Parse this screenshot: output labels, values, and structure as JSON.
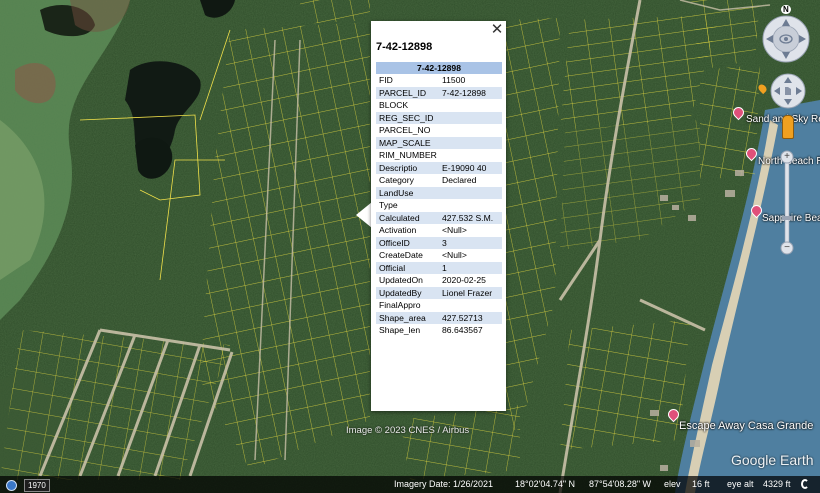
{
  "parcel_id": "7-42-12898",
  "table_header": "7-42-12898",
  "close_glyph": "✕",
  "attributes": [
    {
      "key": "FID",
      "value": "11500"
    },
    {
      "key": "PARCEL_ID",
      "value": "7-42-12898"
    },
    {
      "key": "BLOCK",
      "value": ""
    },
    {
      "key": "REG_SEC_ID",
      "value": ""
    },
    {
      "key": "PARCEL_NO",
      "value": ""
    },
    {
      "key": "MAP_SCALE",
      "value": ""
    },
    {
      "key": "RIM_NUMBER",
      "value": ""
    },
    {
      "key": "Descriptio",
      "value": "E-19090 40"
    },
    {
      "key": "Category",
      "value": "Declared"
    },
    {
      "key": "LandUse",
      "value": ""
    },
    {
      "key": "Type",
      "value": ""
    },
    {
      "key": "Calculated",
      "value": "427.532 S.M."
    },
    {
      "key": "Activation",
      "value": "<Null>"
    },
    {
      "key": "OfficeID",
      "value": "3"
    },
    {
      "key": "CreateDate",
      "value": "<Null>"
    },
    {
      "key": "Official",
      "value": "1"
    },
    {
      "key": "UpdatedOn",
      "value": "2020-02-25"
    },
    {
      "key": "UpdatedBy",
      "value": "Lionel Frazer"
    },
    {
      "key": "FinalAppro",
      "value": ""
    },
    {
      "key": "Shape_area",
      "value": "427.52713"
    },
    {
      "key": "Shape_len",
      "value": "86.643567"
    }
  ],
  "places": [
    {
      "name": "Sand and Sky Resort",
      "icon": "pin-icon"
    },
    {
      "name": "North Beach Resort",
      "icon": "pin-icon"
    },
    {
      "name": "Sapphire Beach",
      "icon": "pin-icon"
    },
    {
      "name": "Escape Away Casa Grande",
      "icon": "pin-icon"
    }
  ],
  "copyright": "Image © 2023 CNES / Airbus",
  "logo": "Google Earth",
  "status": {
    "year": "1970",
    "imagery_date": "Imagery Date: 1/26/2021",
    "lat": "18°02'04.74\" N",
    "lon": "87°54'08.28\" W",
    "elev": "elev",
    "elev_value": "16 ft",
    "eye_alt": "eye alt",
    "eye_alt_value": "4329 ft"
  },
  "nav": {
    "north": "N",
    "zoom_in": "+",
    "zoom_out": "−"
  },
  "colors": {
    "parcel_line": "#f0e04a",
    "popup_header": "#a9c3e6",
    "popup_alt_row": "#d9e4f2",
    "sea": "#4f7fa0",
    "forest": "#2d4a28"
  }
}
